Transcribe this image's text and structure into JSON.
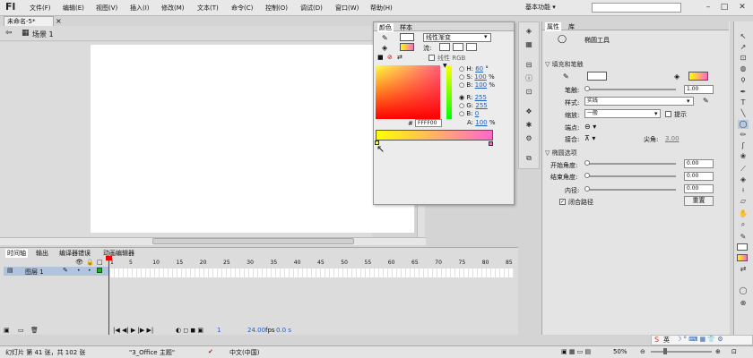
{
  "app": {
    "logo": "Fl",
    "menus": [
      "文件(F)",
      "编辑(E)",
      "视图(V)",
      "插入(I)",
      "修改(M)",
      "文本(T)",
      "命令(C)",
      "控制(O)",
      "调试(D)",
      "窗口(W)",
      "帮助(H)"
    ],
    "workspace": "基本功能 ▾"
  },
  "document": {
    "tab": "未命名-5*",
    "scene": "场景 1"
  },
  "color_panel": {
    "tabs": [
      "颜色",
      "样本"
    ],
    "flow_label": "流:",
    "type": "线性渐变",
    "linear_rgb": "线性 RGB",
    "hsb": [
      {
        "k": "H:",
        "v": "60",
        "u": "°"
      },
      {
        "k": "S:",
        "v": "100",
        "u": "%"
      },
      {
        "k": "B:",
        "v": "100",
        "u": "%"
      }
    ],
    "rgb": [
      {
        "k": "R:",
        "v": "255",
        "u": ""
      },
      {
        "k": "G:",
        "v": "255",
        "u": ""
      },
      {
        "k": "B:",
        "v": "0",
        "u": ""
      }
    ],
    "alpha": {
      "k": "A:",
      "v": "100",
      "u": "%"
    },
    "hex": "FFFF00",
    "hash": "#"
  },
  "properties": {
    "tabs": [
      "属性",
      "库"
    ],
    "tool": "椭圆工具",
    "section1": "▽ 填充和笔触",
    "stroke_label": "笔触:",
    "stroke_value": "1.00",
    "style_label": "样式:",
    "style_value": "实线",
    "scale_label": "缩放:",
    "scale_value": "一般",
    "hint_label": "提示",
    "cap_label": "端点:",
    "join_label": "接合:",
    "miter_label": "尖角:",
    "miter_value": "3.00",
    "section2": "▽ 椭圆选项",
    "start_label": "开始角度:",
    "start_value": "0.00",
    "end_label": "结束角度:",
    "end_value": "0.00",
    "inner_label": "内径:",
    "inner_value": "0.00",
    "close_label": "闭合路径",
    "reset": "重置"
  },
  "timeline": {
    "tabs": [
      "时间轴",
      "输出",
      "编译器错误",
      "动画编辑器"
    ],
    "layer": "图层 1",
    "frame_numbers": [
      "1",
      "5",
      "10",
      "15",
      "20",
      "25",
      "30",
      "35",
      "40",
      "45",
      "50",
      "55",
      "60",
      "65",
      "70",
      "75",
      "80",
      "85"
    ],
    "fps": "24.00",
    "fps_unit": "fps",
    "time": "0.0 s",
    "frame": "1"
  },
  "status": {
    "slide": "幻灯片 第 41 张，共 102 张",
    "theme": "\"3_Office 主题\"",
    "lang": "中文(中国)",
    "zoom": "50%",
    "ime": "英"
  }
}
